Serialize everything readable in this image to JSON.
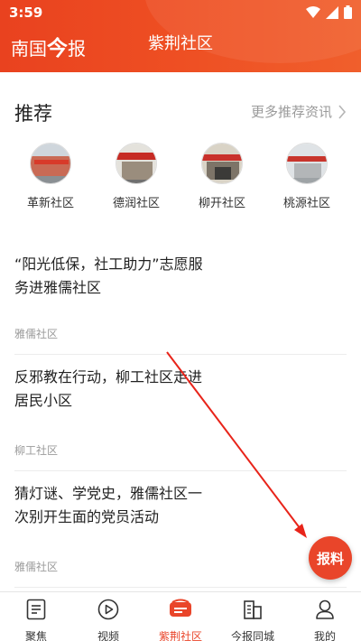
{
  "status_bar": {
    "time": "3:59"
  },
  "header": {
    "logo_part1": "南国",
    "logo_part2": "今",
    "logo_part3": "报",
    "title": "紫荆社区"
  },
  "recommend": {
    "title": "推荐",
    "more_label": "更多推荐资讯",
    "communities": [
      {
        "name": "革新社区"
      },
      {
        "name": "德润社区"
      },
      {
        "name": "柳开社区"
      },
      {
        "name": "桃源社区"
      }
    ]
  },
  "articles": [
    {
      "title": "“阳光低保，社工助力”志愿服务进雅儒社区",
      "source": "雅儒社区"
    },
    {
      "title": "反邪教在行动，柳工社区走进居民小区",
      "source": "柳工社区"
    },
    {
      "title": "猜灯谜、学党史，雅儒社区一次别开生面的党员活动",
      "source": "雅儒社区"
    }
  ],
  "fab": {
    "label": "报料"
  },
  "bottom_nav": [
    {
      "label": "聚焦",
      "icon": "document-icon"
    },
    {
      "label": "视频",
      "icon": "play-icon"
    },
    {
      "label": "紫荆社区",
      "icon": "chat-icon",
      "active": true
    },
    {
      "label": "今报同城",
      "icon": "building-icon"
    },
    {
      "label": "我的",
      "icon": "user-icon"
    }
  ],
  "colors": {
    "brand": "#e9452a",
    "annotation": "#e8241a"
  }
}
